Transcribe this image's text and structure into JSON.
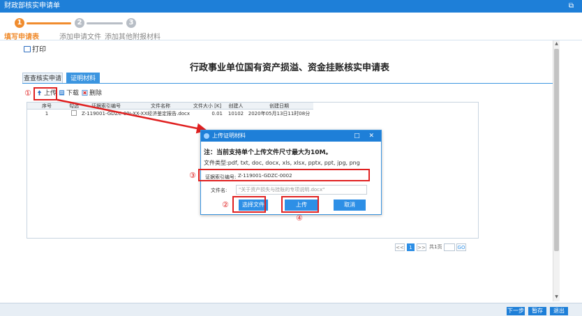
{
  "window": {
    "title": "财政部核实申请单"
  },
  "steps": [
    {
      "number": "1",
      "label": "填写申请表"
    },
    {
      "number": "2",
      "label": "添加申请文件"
    },
    {
      "number": "3",
      "label": "添加其他附报材料"
    }
  ],
  "print_label": "打印",
  "document_title": "行政事业单位国有资产损溢、资金挂账核实申请表",
  "tabs": [
    {
      "label": "查查核实申请"
    },
    {
      "label": "证明材料"
    }
  ],
  "toolbar": {
    "upload": "上传",
    "download": "下载",
    "delete": "删除"
  },
  "table": {
    "headers": [
      "序号",
      "勾选",
      "证据索引编号",
      "文件名称",
      "文件大小 [K]",
      "创建人",
      "创建日期"
    ],
    "rows": [
      [
        "1",
        "",
        "Z-119001-GDZC-0001",
        "-XX-XX经济鉴定报告.docx",
        "0.01",
        "10102",
        "2020年05月13日11时08分"
      ]
    ]
  },
  "pager": {
    "first": "<<",
    "page": "1",
    "next": ">>",
    "total": "共1页",
    "go": "GO"
  },
  "modal": {
    "title": "上传证明材料",
    "note": "注：当前支持单个上传文件尺寸最大为10M。",
    "file_types": "文件类型:pdf, txt, doc, docx, xls, xlsx, pptx, ppt, jpg, png",
    "evidence_label": "证据索引编号:",
    "evidence_value": "Z-119001-GDZC-0002",
    "filename_label": "文件名:",
    "filename_placeholder": "\"关于资产损失与挂账的专项说明.docx\"",
    "choose_file": "选择文件",
    "upload": "上传",
    "cancel": "取消"
  },
  "annotations": {
    "n1": "①",
    "n2": "②",
    "n3": "③",
    "n4": "④"
  },
  "footer": {
    "prev": "下一步",
    "save": "暂存",
    "exit": "退出"
  },
  "colors": {
    "primary": "#1e7fd8",
    "accent": "#f08c2e",
    "annotation": "#e02020"
  }
}
